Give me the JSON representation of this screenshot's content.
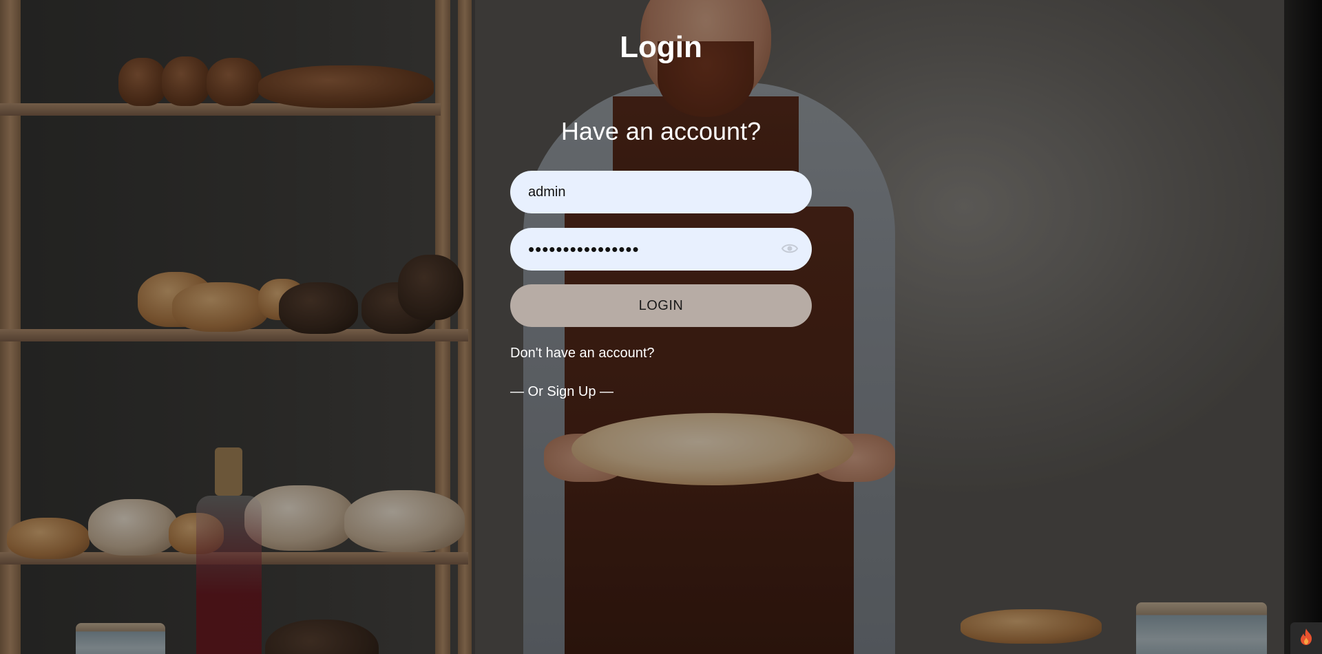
{
  "page": {
    "title": "Login",
    "subtitle": "Have an account?"
  },
  "form": {
    "username_value": "admin",
    "password_masked": "••••••••••••••••",
    "password_length": 16,
    "login_label": "LOGIN",
    "no_account_text": "Don't have an account?",
    "signup_label": "— Or Sign Up —"
  },
  "icons": {
    "password_toggle": "eye-icon",
    "corner_badge": "flame-icon"
  },
  "colors": {
    "input_bg": "#e8f0fe",
    "button_bg": "#b7aca5",
    "text": "#ffffff",
    "badge_flame": "#e8522f"
  }
}
